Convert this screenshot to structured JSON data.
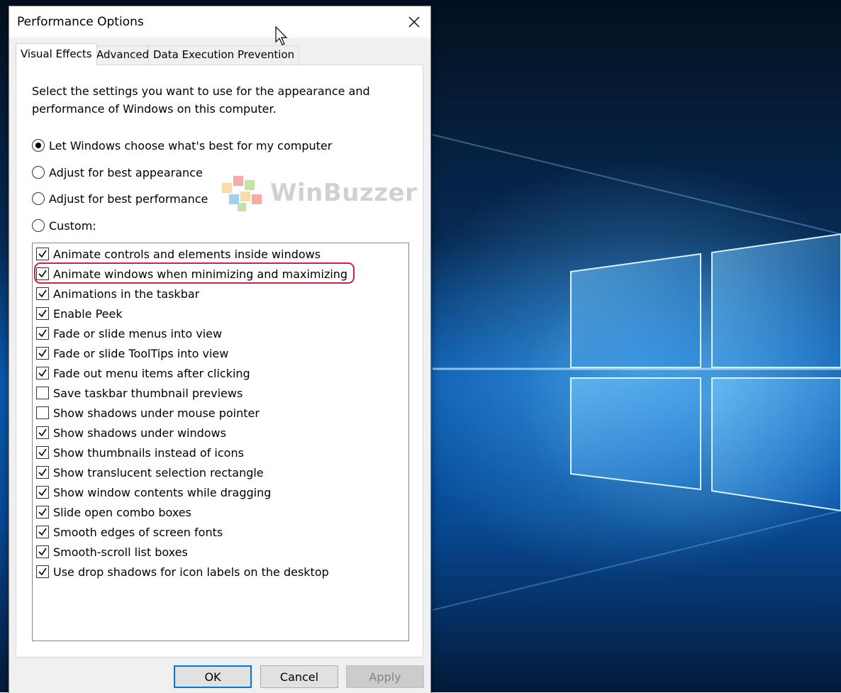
{
  "window": {
    "title": "Performance Options",
    "close_icon": "close-icon"
  },
  "tabs": [
    {
      "label": "Visual Effects",
      "active": true
    },
    {
      "label": "Advanced",
      "active": false
    },
    {
      "label": "Data Execution Prevention",
      "active": false
    }
  ],
  "visual_effects": {
    "intro_line1": "Select the settings you want to use for the appearance and",
    "intro_line2": "performance of Windows on this computer.",
    "options": [
      {
        "label": "Let Windows choose what's best for my computer",
        "selected": true
      },
      {
        "label": "Adjust for best appearance",
        "selected": false
      },
      {
        "label": "Adjust for best performance",
        "selected": false
      },
      {
        "label": "Custom:",
        "selected": false
      }
    ],
    "watermark": "WinBuzzer",
    "effects": [
      {
        "label": "Animate controls and elements inside windows",
        "checked": true
      },
      {
        "label": "Animate windows when minimizing and maximizing",
        "checked": true,
        "highlighted": true
      },
      {
        "label": "Animations in the taskbar",
        "checked": true
      },
      {
        "label": "Enable Peek",
        "checked": true
      },
      {
        "label": "Fade or slide menus into view",
        "checked": true
      },
      {
        "label": "Fade or slide ToolTips into view",
        "checked": true
      },
      {
        "label": "Fade out menu items after clicking",
        "checked": true
      },
      {
        "label": "Save taskbar thumbnail previews",
        "checked": false
      },
      {
        "label": "Show shadows under mouse pointer",
        "checked": false
      },
      {
        "label": "Show shadows under windows",
        "checked": true
      },
      {
        "label": "Show thumbnails instead of icons",
        "checked": true
      },
      {
        "label": "Show translucent selection rectangle",
        "checked": true
      },
      {
        "label": "Show window contents while dragging",
        "checked": true
      },
      {
        "label": "Slide open combo boxes",
        "checked": true
      },
      {
        "label": "Smooth edges of screen fonts",
        "checked": true
      },
      {
        "label": "Smooth-scroll list boxes",
        "checked": true
      },
      {
        "label": "Use drop shadows for icon labels on the desktop",
        "checked": true
      }
    ]
  },
  "buttons": {
    "ok": "OK",
    "cancel": "Cancel",
    "apply": "Apply",
    "apply_enabled": false
  },
  "colors": {
    "highlight_ring": "#d0223a",
    "default_button_border": "#0078d7",
    "desktop_blue": "#0a5bb0"
  }
}
